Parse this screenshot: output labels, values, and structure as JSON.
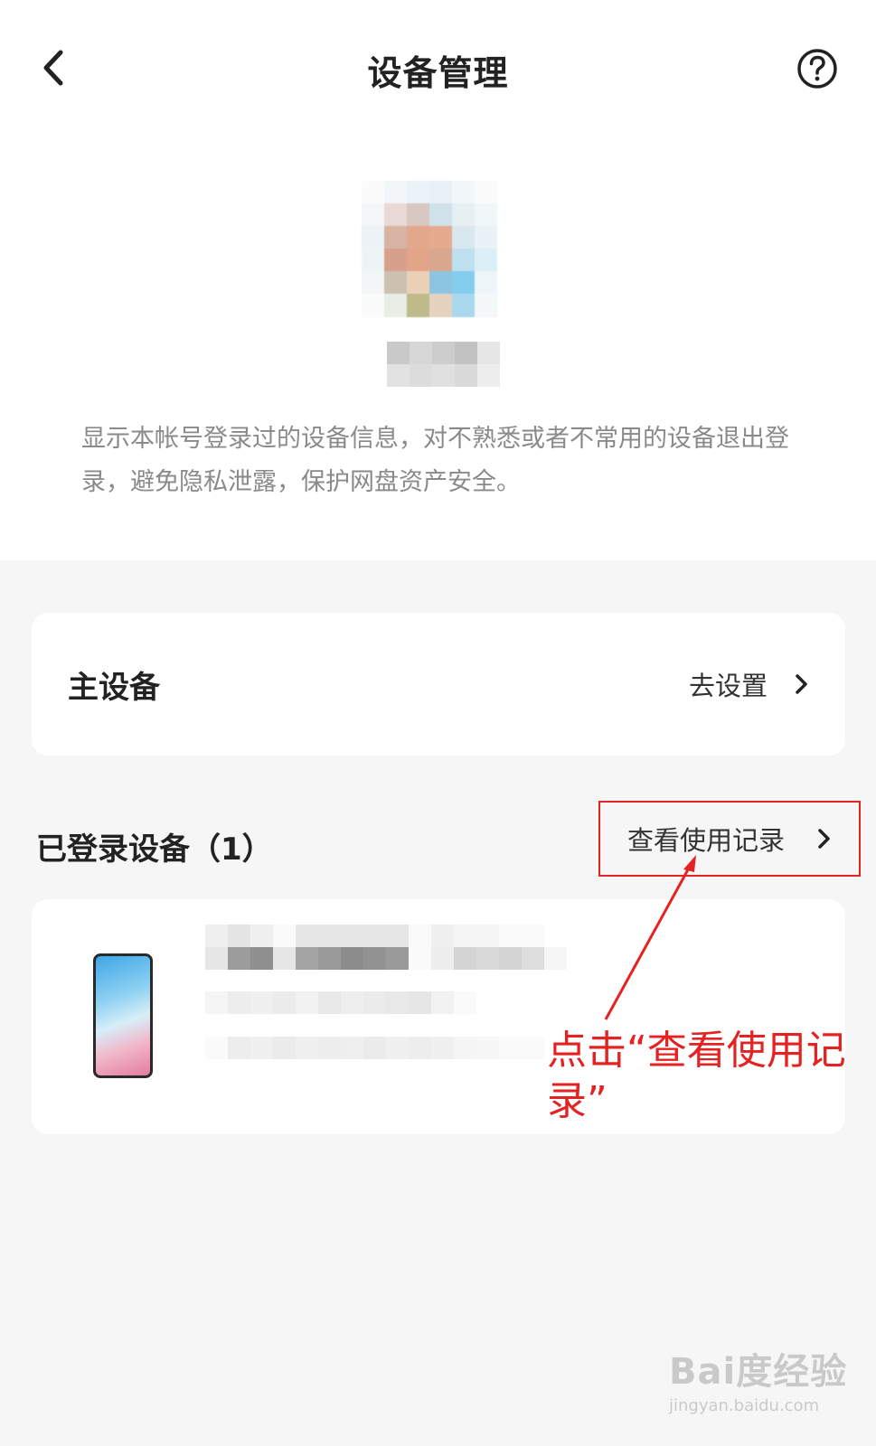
{
  "header": {
    "title": "设备管理",
    "back_icon": "chevron-left-icon",
    "help_icon": "question-circle-icon"
  },
  "description": "显示本帐号登录过的设备信息，对不熟悉或者不常用的设备退出登录，避免隐私泄露，保护网盘资产安全。",
  "primary_device": {
    "label": "主设备",
    "action_label": "去设置"
  },
  "logged_in": {
    "title": "已登录设备（1）",
    "view_log_label": "查看使用记录"
  },
  "annotation": {
    "text": "点击“查看使用记录”",
    "color": "#e52222"
  },
  "watermark": {
    "brand": "Bai度经验",
    "url": "jingyan.baidu.com"
  }
}
